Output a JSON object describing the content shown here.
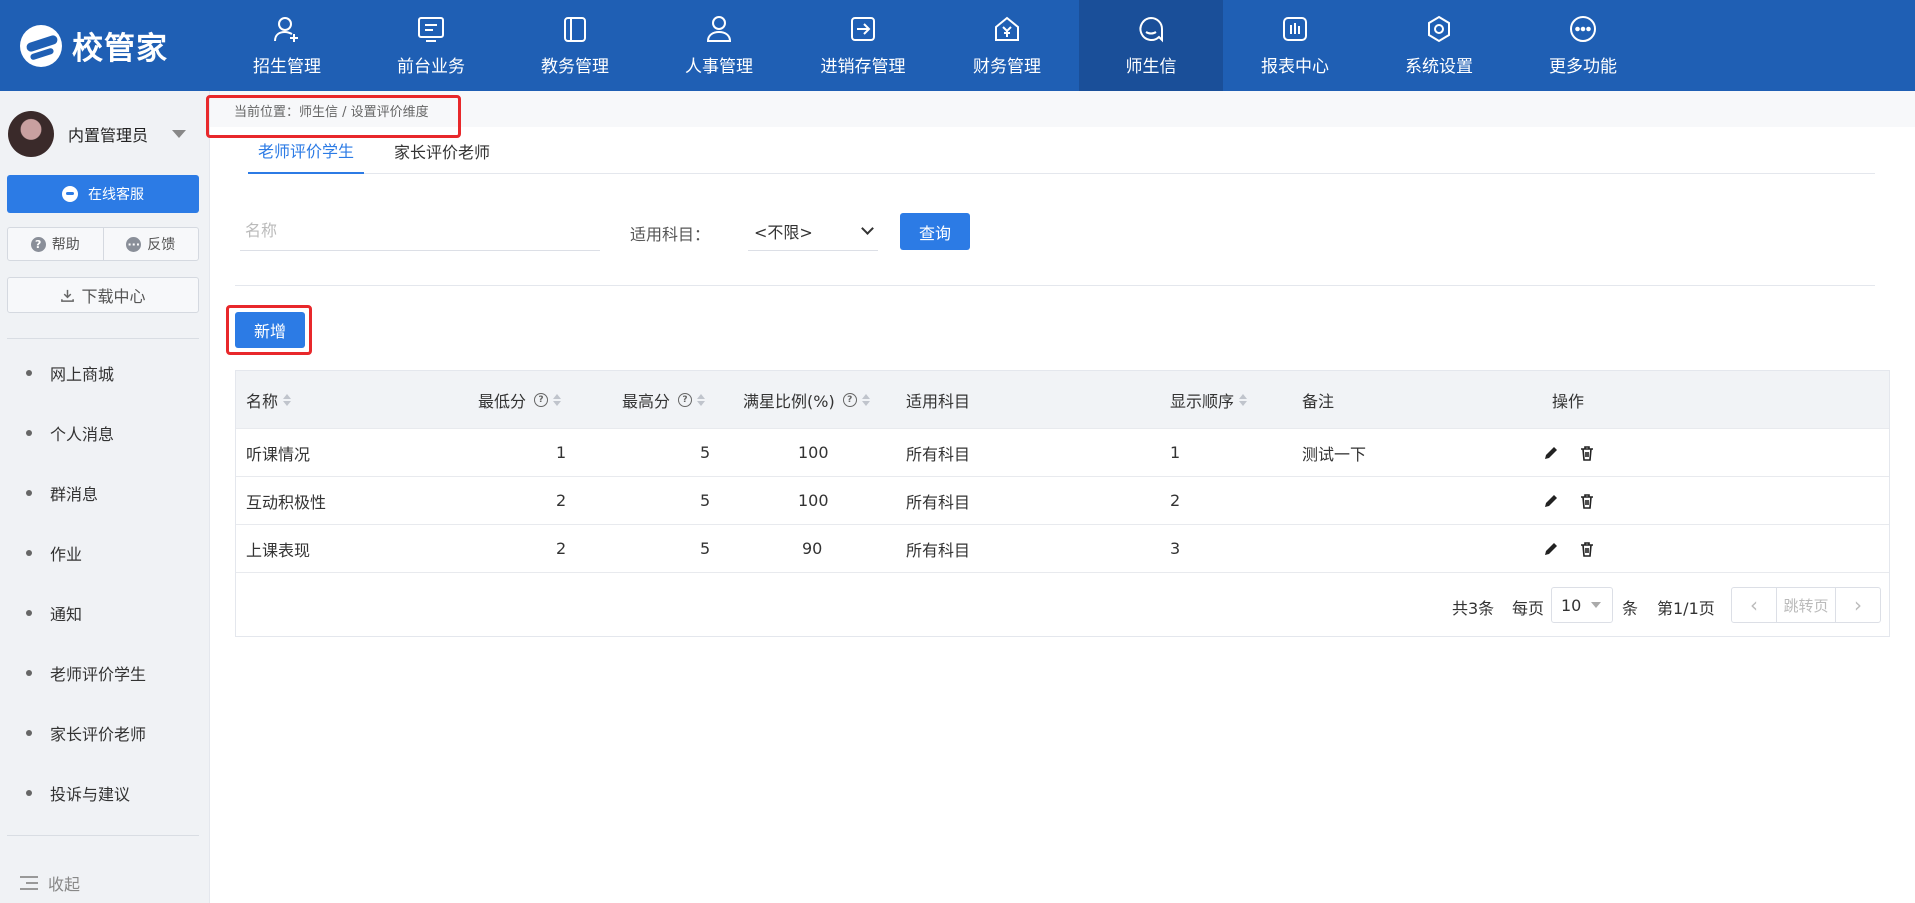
{
  "app": {
    "logo_text": "校管家"
  },
  "colors": {
    "primary": "#1f5fb4",
    "accent": "#2c7be5",
    "highlight": "#e8282b"
  },
  "nav": [
    {
      "label": "招生管理",
      "icon": "user-plus-icon"
    },
    {
      "label": "前台业务",
      "icon": "screen-icon"
    },
    {
      "label": "教务管理",
      "icon": "book-icon"
    },
    {
      "label": "人事管理",
      "icon": "person-icon"
    },
    {
      "label": "进销存管理",
      "icon": "arrow-box-icon"
    },
    {
      "label": "财务管理",
      "icon": "yuan-house-icon"
    },
    {
      "label": "师生信",
      "icon": "chat-icon",
      "active": true
    },
    {
      "label": "报表中心",
      "icon": "bar-chart-icon"
    },
    {
      "label": "系统设置",
      "icon": "settings-icon"
    },
    {
      "label": "更多功能",
      "icon": "more-icon"
    }
  ],
  "sidebar": {
    "user_name": "内置管理员",
    "service_label": "在线客服",
    "help_label": "帮助",
    "feedback_label": "反馈",
    "download_label": "下载中心",
    "items": [
      "网上商城",
      "个人消息",
      "群消息",
      "作业",
      "通知",
      "老师评价学生",
      "家长评价老师",
      "投诉与建议"
    ],
    "collapse_label": "收起"
  },
  "breadcrumb": "当前位置：师生信 / 设置评价维度",
  "tabs": [
    {
      "label": "老师评价学生",
      "active": true
    },
    {
      "label": "家长评价老师",
      "active": false
    }
  ],
  "filters": {
    "name_placeholder": "名称",
    "subject_label": "适用科目：",
    "subject_value": "<不限>",
    "query_label": "查询"
  },
  "add_label": "新增",
  "table": {
    "headers": [
      "名称",
      "最低分",
      "最高分",
      "满星比例(%)",
      "适用科目",
      "显示顺序",
      "备注",
      "操作"
    ],
    "rows": [
      {
        "name": "听课情况",
        "min": "1",
        "max": "5",
        "ratio": "100",
        "subject": "所有科目",
        "order": "1",
        "note": "测试一下"
      },
      {
        "name": "互动积极性",
        "min": "2",
        "max": "5",
        "ratio": "100",
        "subject": "所有科目",
        "order": "2",
        "note": ""
      },
      {
        "name": "上课表现",
        "min": "2",
        "max": "5",
        "ratio": "90",
        "subject": "所有科目",
        "order": "3",
        "note": ""
      }
    ]
  },
  "pager": {
    "total": "共3条",
    "per_page_label": "每页",
    "per_page_value": "10",
    "unit": "条",
    "page_info": "第1/1页",
    "jump_label": "跳转页"
  }
}
